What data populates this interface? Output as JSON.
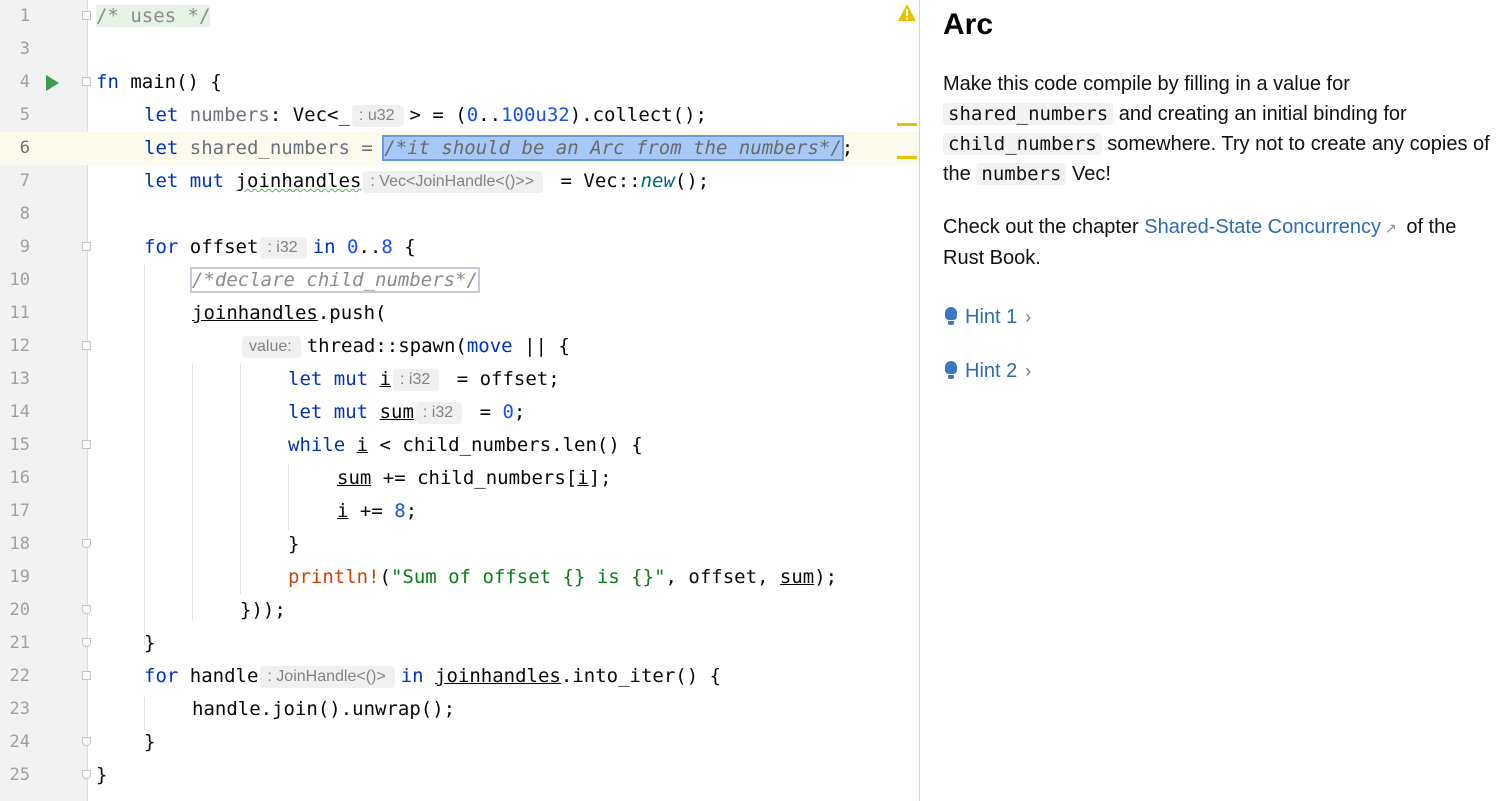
{
  "editor": {
    "lines": [
      {
        "n": "1",
        "code": "/* uses */"
      },
      {
        "n": "3",
        "code": ""
      },
      {
        "n": "4",
        "code": "fn main() {"
      },
      {
        "n": "5",
        "code": "let numbers: Vec<_ : u32 > = (0..100u32).collect();"
      },
      {
        "n": "6",
        "code": "let shared_numbers = /*it should be an Arc from the numbers*/;"
      },
      {
        "n": "7",
        "code": "let mut joinhandles : Vec<JoinHandle<()>> = Vec::new();"
      },
      {
        "n": "8",
        "code": ""
      },
      {
        "n": "9",
        "code": "for offset : i32 in 0..8 {"
      },
      {
        "n": "10",
        "code": "/*declare child_numbers*/"
      },
      {
        "n": "11",
        "code": "joinhandles.push("
      },
      {
        "n": "12",
        "code": "value: thread::spawn(move || {"
      },
      {
        "n": "13",
        "code": "let mut i : i32 = offset;"
      },
      {
        "n": "14",
        "code": "let mut sum : i32 = 0;"
      },
      {
        "n": "15",
        "code": "while i < child_numbers.len() {"
      },
      {
        "n": "16",
        "code": "sum += child_numbers[i];"
      },
      {
        "n": "17",
        "code": "i += 8;"
      },
      {
        "n": "18",
        "code": "}"
      },
      {
        "n": "19",
        "code": "println!(\"Sum of offset {} is {}\", offset, sum);"
      },
      {
        "n": "20",
        "code": "}));"
      },
      {
        "n": "21",
        "code": "}"
      },
      {
        "n": "22",
        "code": "for handle : JoinHandle<()> in joinhandles.into_iter() {"
      },
      {
        "n": "23",
        "code": "handle.join().unwrap();"
      },
      {
        "n": "24",
        "code": "}"
      },
      {
        "n": "25",
        "code": "}"
      }
    ],
    "tokens": {
      "l1": "/* uses */",
      "fn": "fn",
      "main": " main() {",
      "let": "let",
      "mut": "mut",
      "for": "for",
      "in": "in",
      "move": "move",
      "while": "while",
      "numbers": " numbers",
      "numbers_rest1": ": Vec<_",
      "hint_u32": ": u32",
      "numbers_rest2": "> = (",
      "zero": "0",
      "range": "..",
      "hundred": "100u32",
      "collect": ").collect();",
      "shared": " shared_numbers = ",
      "placeholder_arc": "/*it should be an Arc from the numbers*/",
      "semi": ";",
      "joinhandles": "joinhandles",
      "hint_vec": ": Vec<JoinHandle<()>>",
      "vec_new_a": " = Vec::",
      "vec_new_b": "new",
      "vec_new_c": "();",
      "offset": " offset",
      "hint_i32": ": i32",
      "eight": "8",
      "brace_open": " {",
      "placeholder_child": "/*declare child_numbers*/",
      "push": ".push(",
      "hint_value": "value:",
      "spawn": "thread::spawn(",
      "pipes": " || {",
      "i": "i",
      "eq_offset": " = offset;",
      "sum": "sum",
      "eq_zero_a": " = ",
      "eq_zero_b": ";",
      "lt_len": " < child_numbers.len() {",
      "plus_eq": " += child_numbers[",
      "idx_close": "];",
      "i_plus": " += ",
      "close_brace": "}",
      "println": "println!",
      "paren_open": "(",
      "fmt_str": "\"Sum of offset {} is {}\"",
      "println_rest_a": ", offset, ",
      "println_rest_b": ");",
      "close_spawn": "}));",
      "handle": " handle",
      "hint_jh": ": JoinHandle<()>",
      "into_iter": ".into_iter() {",
      "join": "handle.join().unwrap();"
    }
  },
  "panel": {
    "title": "Arc",
    "p1": {
      "t1": "Make this code compile by filling in a value for",
      "c1": "shared_numbers",
      "t2": " and creating an initial binding for",
      "c2": "child_numbers",
      "t3": " somewhere. Try not to create any copies of the",
      "c3": "numbers",
      "t4": " Vec!"
    },
    "p2": {
      "t1": "Check out the chapter ",
      "link": "Shared-State Concurrency",
      "t2": " of the Rust Book."
    },
    "hints": [
      {
        "label": "Hint 1"
      },
      {
        "label": "Hint 2"
      }
    ]
  },
  "colors": {
    "keyword": "#0033b3",
    "number": "#1750eb",
    "string": "#067d17",
    "macro": "#c7450b",
    "link": "#2f6bb0",
    "run": "#3c9a48",
    "warning": "#e8c100"
  },
  "icons": {
    "run": "run-gutter-icon",
    "warning": "warning-icon",
    "hint": "lightbulb-icon",
    "external": "external-link-icon",
    "chevron": "chevron-right-icon"
  }
}
